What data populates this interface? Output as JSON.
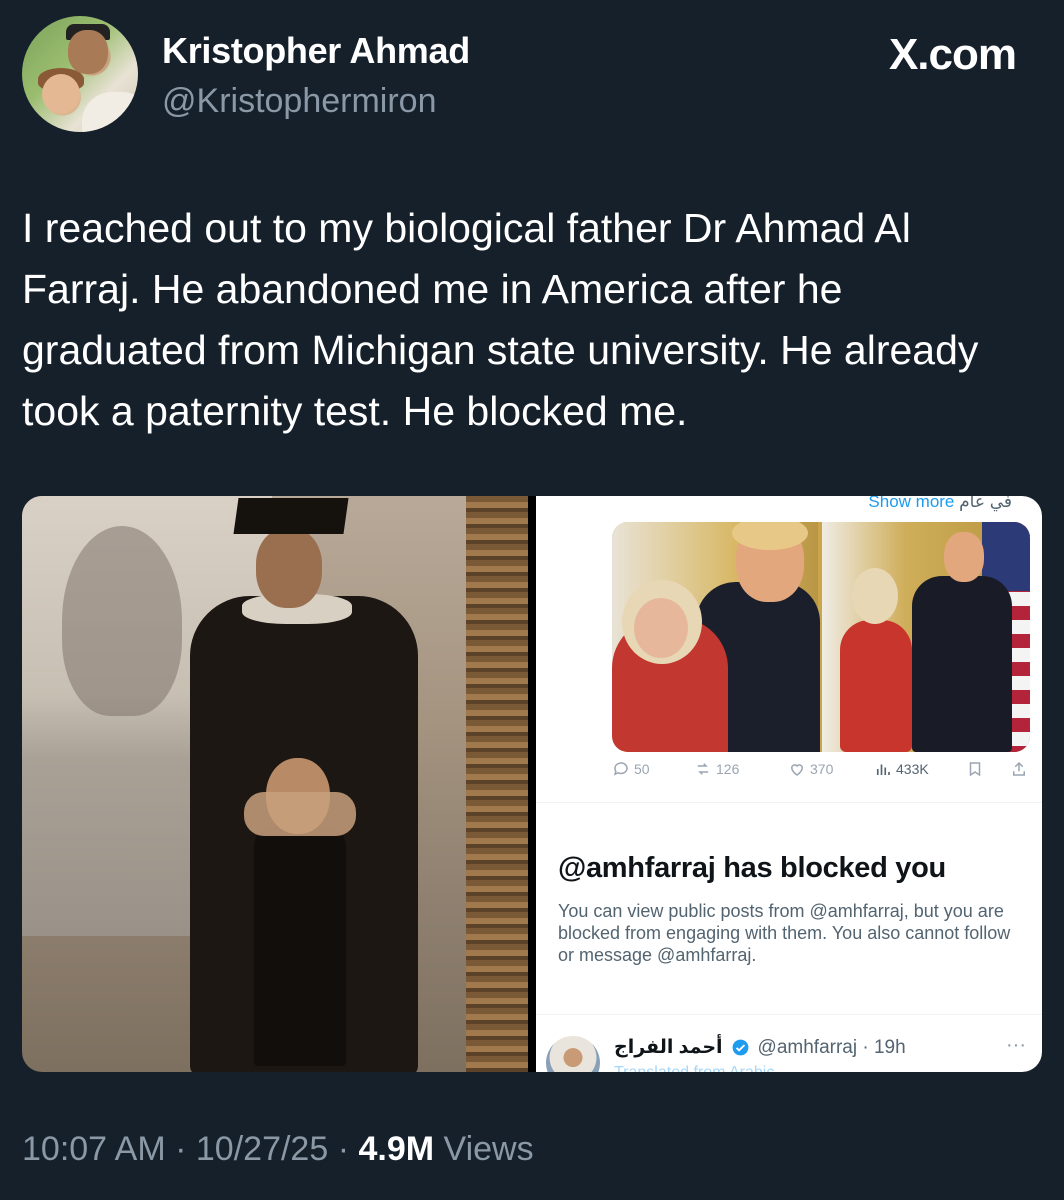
{
  "header": {
    "display_name": "Kristopher Ahmad",
    "handle": "@Kristophermiron",
    "brand": "X.com"
  },
  "tweet": {
    "text": "I reached out to my biological father Dr Ahmad Al Farraj. He abandoned me in America after he graduated from Michigan state university. He already took a paternity test. He blocked me."
  },
  "embedded_screenshot": {
    "show_more": "Show more",
    "show_more_arabic": "في عام",
    "actions": {
      "replies": "50",
      "reposts": "126",
      "likes": "370",
      "views": "433K"
    },
    "blocked_title": "@amhfarraj has blocked you",
    "blocked_body": "You can view public posts from @amhfarraj, but you are blocked from engaging with them. You also cannot follow or message @amhfarraj.",
    "reply": {
      "name": "أحمد الفراج",
      "handle_time": "@amhfarraj · 19h",
      "more": "···",
      "subline": "Translated from Arabic"
    }
  },
  "footer": {
    "time": "10:07 AM",
    "date": "10/27/25",
    "views_count": "4.9M",
    "views_label": "Views",
    "separator": "·"
  },
  "colors": {
    "background": "#15202b",
    "secondary_text": "#8b98a5",
    "link": "#1d9bf0"
  }
}
